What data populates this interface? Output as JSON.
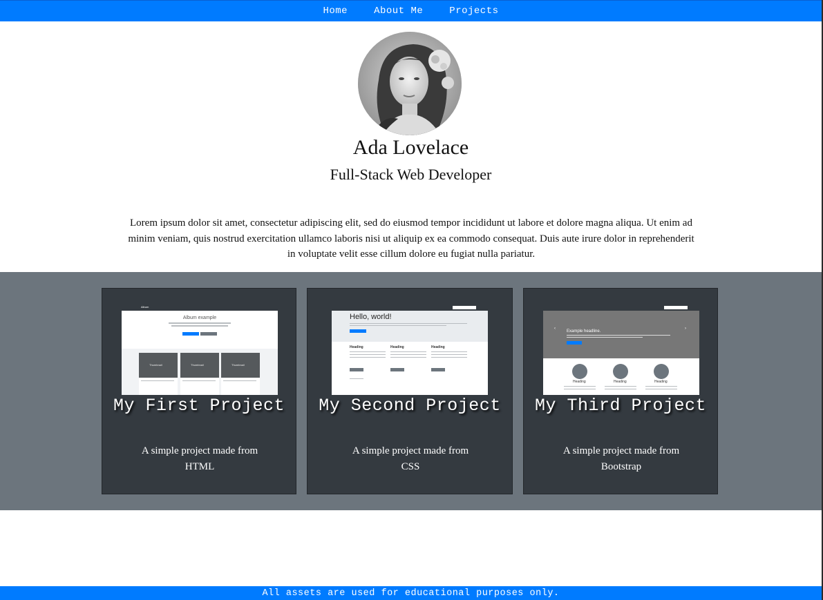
{
  "nav": {
    "links": [
      "Home",
      "About Me",
      "Projects"
    ]
  },
  "profile": {
    "name": "Ada Lovelace",
    "role": "Full-Stack Web Developer",
    "avatar_icon": "portrait-image",
    "bio": "Lorem ipsum dolor sit amet, consectetur adipiscing elit, sed do eiusmod tempor incididunt ut labore et dolore magna aliqua. Ut enim ad minim veniam, quis nostrud exercitation ullamco laboris nisi ut aliquip ex ea commodo consequat. Duis aute irure dolor in reprehenderit in voluptate velit esse cillum dolore eu fugiat nulla pariatur."
  },
  "projects": [
    {
      "title": "My First Project",
      "description": "A simple project made from HTML",
      "thumb": {
        "brand": "Album",
        "heading": "Album example",
        "card_label": "Thumbnail"
      }
    },
    {
      "title": "My Second Project",
      "description": "A simple project made from CSS",
      "thumb": {
        "heading": "Hello, world!",
        "button": "Learn more »",
        "col_heading": "Heading",
        "col_button": "View details »"
      }
    },
    {
      "title": "My Third Project",
      "description": "A simple project made from Bootstrap",
      "thumb": {
        "headline": "Example headline.",
        "button": "Sign up today",
        "col_heading": "Heading"
      }
    }
  ],
  "footer": {
    "text": "All assets are used for educational purposes only."
  },
  "colors": {
    "primary": "#007bff",
    "band": "#6c757d",
    "card": "#343a40"
  }
}
